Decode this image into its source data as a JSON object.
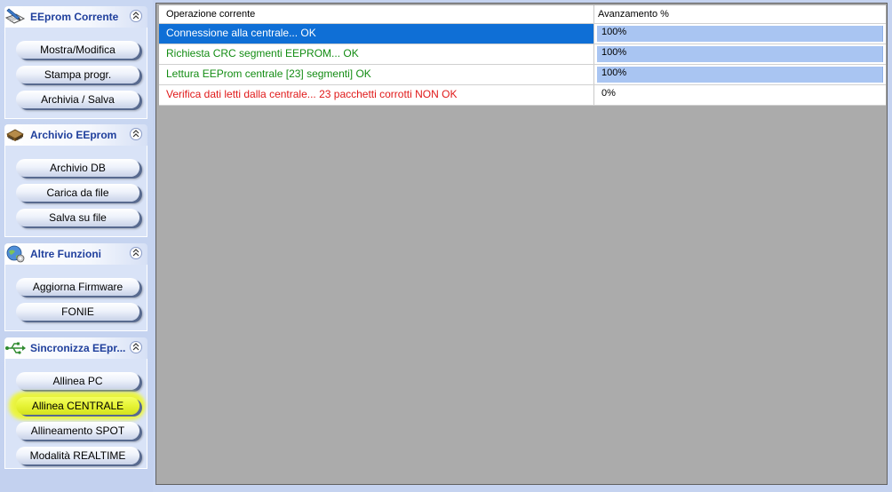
{
  "sidebar": {
    "groups": [
      {
        "title": "EEprom Corrente",
        "icon": "pen-document-icon",
        "buttons": [
          "Mostra/Modifica",
          "Stampa progr.",
          "Archivia / Salva"
        ]
      },
      {
        "title": "Archivio  EEprom",
        "icon": "chip-icon",
        "buttons": [
          "Archivio DB",
          "Carica da file",
          "Salva su file"
        ]
      },
      {
        "title": "Altre Funzioni",
        "icon": "globe-gear-icon",
        "buttons": [
          "Aggiorna Firmware",
          "FONIE"
        ]
      },
      {
        "title": "Sincronizza EEpr...",
        "icon": "usb-icon",
        "buttons": [
          "Allinea PC",
          "Allinea CENTRALE",
          "Allineamento SPOT",
          "Modalità REALTIME"
        ],
        "highlighted_button": "Allinea CENTRALE"
      }
    ]
  },
  "table": {
    "columns": [
      "Operazione corrente",
      "Avanzamento %"
    ],
    "rows": [
      {
        "operation": "Connessione alla centrale...    OK",
        "progress_label": "100%",
        "progress": 100,
        "selected": true,
        "color": "#ffffff"
      },
      {
        "operation": "Richiesta CRC segmenti EEPROM...    OK",
        "progress_label": "100%",
        "progress": 100,
        "color": "#138c13"
      },
      {
        "operation": "Lettura EEProm centrale [23]  segmenti]    OK",
        "progress_label": "100%",
        "progress": 100,
        "color": "#138c13"
      },
      {
        "operation": "Verifica dati letti dalla centrale... 23  pacchetti corrotti     NON OK",
        "progress_label": "0%",
        "progress": 0,
        "color": "#e01818"
      }
    ]
  },
  "colors": {
    "selection": "#0f6fd6",
    "progress_fill": "#a9c5f2",
    "ok_text": "#138c13",
    "error_text": "#e01818",
    "highlight": "#e6f335"
  }
}
